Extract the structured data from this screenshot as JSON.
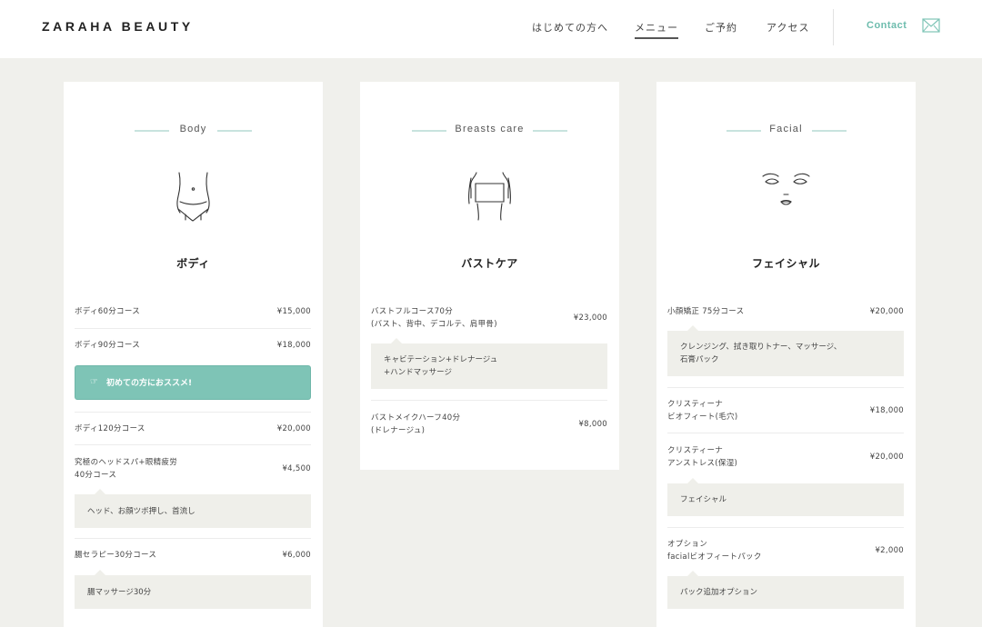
{
  "header": {
    "logo": "ZARAHA BEAUTY",
    "nav": [
      {
        "label": "はじめての方へ"
      },
      {
        "label": "メニュー"
      },
      {
        "label": "ご予約"
      },
      {
        "label": "アクセス"
      }
    ],
    "active_nav": "メニュー",
    "contact_label": "Contact",
    "mail_icon": "mail-icon"
  },
  "colors": {
    "accent": "#7ec4b6",
    "background": "#f0f0ec",
    "note_bg": "#efefea",
    "heading_line": "#c8e3de"
  },
  "cards": [
    {
      "title_en": "Body",
      "title_jp": "ボディ",
      "illustration": "body-torso-icon",
      "rows": [
        {
          "name": "ボディ60分コース",
          "price": "¥15,000"
        },
        {
          "name": "ボディ90分コース",
          "price": "¥18,000"
        },
        {
          "name": "ボディ120分コース",
          "price": "¥20,000"
        },
        {
          "name_lines": [
            "究極のヘッドスパ+眼精疲労",
            "40分コース"
          ],
          "price": "¥4,500"
        },
        {
          "name": "腸セラピー30分コース",
          "price": "¥6,000"
        }
      ],
      "recommend": {
        "icon": "hand-point-icon",
        "label": "初めての方におススメ!"
      },
      "notes": [
        {
          "text": "ヘッド、お顔ツボ押し、首流し"
        },
        {
          "text": "腸マッサージ30分"
        }
      ]
    },
    {
      "title_en": "Breasts care",
      "title_jp": "バストケア",
      "illustration": "bust-icon",
      "rows": [
        {
          "name_lines": [
            "バストフルコース70分",
            "(バスト、背中、デコルテ、肩甲骨)"
          ],
          "price": "¥23,000"
        },
        {
          "name_lines": [
            "バストメイクハーフ40分",
            "(ドレナージュ)"
          ],
          "price": "¥8,000"
        }
      ],
      "notes": [
        {
          "lines": [
            "キャビテーション+ドレナージュ",
            "+ハンドマッサージ"
          ]
        }
      ]
    },
    {
      "title_en": "Facial",
      "title_jp": "フェイシャル",
      "illustration": "face-icon",
      "rows": [
        {
          "name": "小顔矯正 75分コース",
          "price": "¥20,000"
        },
        {
          "name_lines": [
            "クリスティーナ",
            "ビオフィート(毛穴)"
          ],
          "price": "¥18,000"
        },
        {
          "name_lines": [
            "クリスティーナ",
            "アンストレス(保湿)"
          ],
          "price": "¥20,000"
        },
        {
          "name_lines": [
            "オプション",
            "facialビオフィートパック"
          ],
          "price": "¥2,000"
        }
      ],
      "notes": [
        {
          "lines": [
            "クレンジング、拭き取りトナー、マッサージ、",
            "石膏パック"
          ]
        },
        {
          "text": "フェイシャル"
        },
        {
          "text": "パック追加オプション"
        }
      ]
    }
  ]
}
